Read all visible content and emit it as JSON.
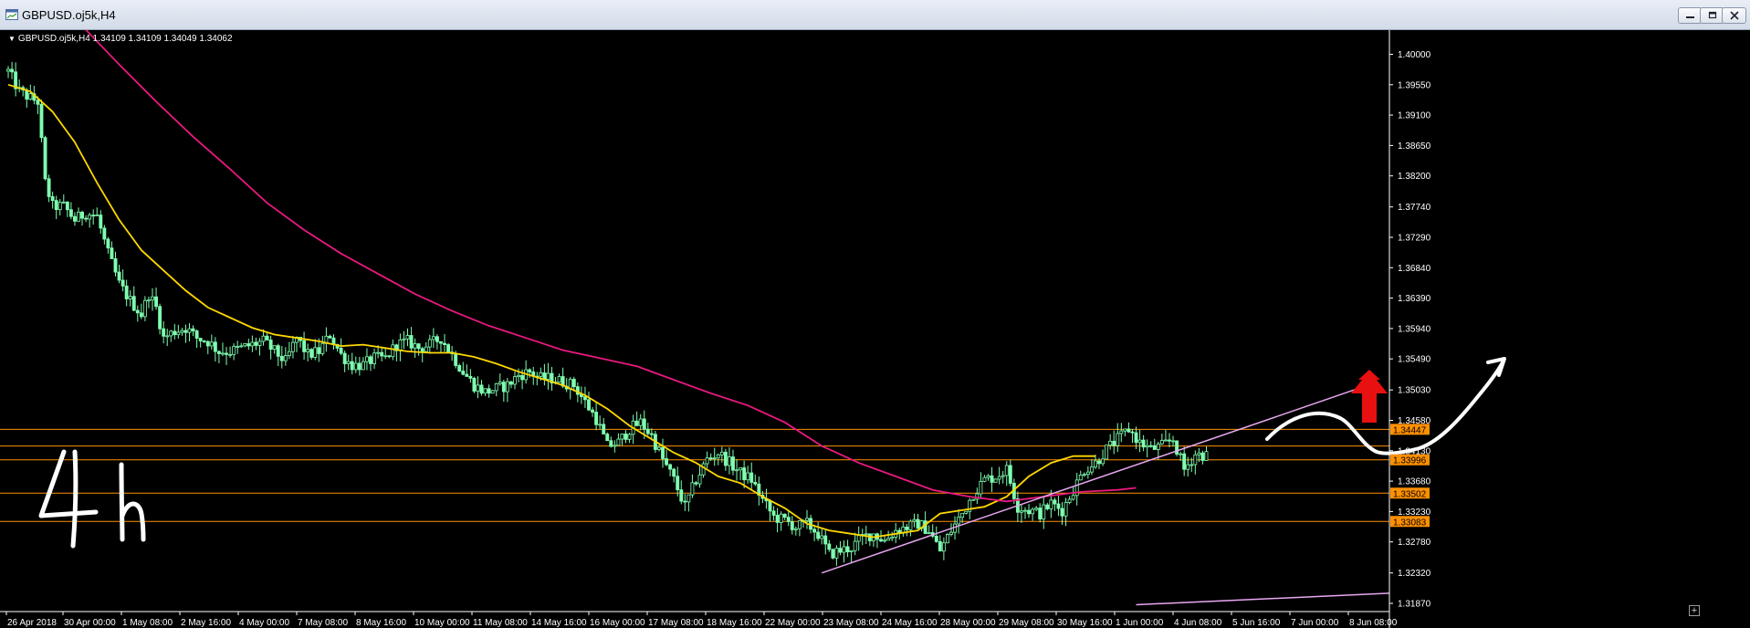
{
  "window": {
    "title": "GBPUSD.oj5k,H4",
    "icon": "chart-window-icon",
    "buttons": [
      "minimize-icon",
      "restore-icon",
      "close-icon"
    ]
  },
  "chart_header": "GBPUSD.oj5k,H4  1.34109 1.34109 1.34049 1.34062",
  "annotation_text": "4 h",
  "colors": {
    "background": "#000000",
    "bull": "#7fffb0",
    "bear": "#000000",
    "ma_fast": "#ffd700",
    "ma_slow": "#e8197f",
    "hline": "#ff9000",
    "trendline": "#e8a8f0",
    "arrow": "#e81010",
    "drawing": "#ffffff",
    "axis_text": "#ffffff"
  },
  "chart_data": {
    "type": "candlestick",
    "symbol": "GBPUSD.oj5k",
    "timeframe": "H4",
    "ohlc_last": {
      "open": 1.34109,
      "high": 1.34109,
      "low": 1.34049,
      "close": 1.34062
    },
    "y_ticks": [
      "1.40000",
      "1.39550",
      "1.39100",
      "1.38650",
      "1.38200",
      "1.37740",
      "1.37290",
      "1.36840",
      "1.36390",
      "1.35940",
      "1.35490",
      "1.35030",
      "1.34580",
      "1.34130",
      "1.33680",
      "1.33230",
      "1.32780",
      "1.32320",
      "1.31870"
    ],
    "ylim": [
      1.3187,
      1.4025
    ],
    "x_ticks": [
      "26 Apr 2018",
      "30 Apr 00:00",
      "1 May 08:00",
      "2 May 16:00",
      "4 May 00:00",
      "7 May 08:00",
      "8 May 16:00",
      "10 May 00:00",
      "11 May 08:00",
      "14 May 16:00",
      "16 May 00:00",
      "17 May 08:00",
      "18 May 16:00",
      "22 May 00:00",
      "23 May 08:00",
      "24 May 16:00",
      "28 May 00:00",
      "29 May 08:00",
      "30 May 16:00",
      "1 Jun 00:00",
      "4 Jun 08:00",
      "5 Jun 16:00",
      "7 Jun 00:00",
      "8 Jun 08:00"
    ],
    "horizontal_levels": [
      {
        "price": 1.34447,
        "label": "1.34447"
      },
      {
        "price": 1.33996,
        "label": "1.33996"
      },
      {
        "price": 1.33502,
        "label": "1.33502"
      },
      {
        "price": 1.33083,
        "label": "1.33083"
      }
    ],
    "extra_level": 1.342,
    "moving_averages": [
      {
        "role": "fast",
        "values": [
          [
            0,
            1.3955
          ],
          [
            6,
            1.3945
          ],
          [
            12,
            1.3915
          ],
          [
            18,
            1.387
          ],
          [
            24,
            1.381
          ],
          [
            30,
            1.3755
          ],
          [
            36,
            1.371
          ],
          [
            42,
            1.368
          ],
          [
            48,
            1.365
          ],
          [
            54,
            1.3625
          ],
          [
            60,
            1.361
          ],
          [
            66,
            1.3595
          ],
          [
            72,
            1.3585
          ],
          [
            78,
            1.358
          ],
          [
            84,
            1.3575
          ],
          [
            90,
            1.3568
          ],
          [
            96,
            1.357
          ],
          [
            102,
            1.3565
          ],
          [
            108,
            1.356
          ],
          [
            114,
            1.3558
          ],
          [
            120,
            1.3558
          ],
          [
            126,
            1.3552
          ],
          [
            132,
            1.3542
          ],
          [
            138,
            1.353
          ],
          [
            144,
            1.352
          ],
          [
            150,
            1.351
          ],
          [
            156,
            1.3495
          ],
          [
            162,
            1.3475
          ],
          [
            168,
            1.345
          ],
          [
            174,
            1.343
          ],
          [
            180,
            1.341
          ],
          [
            186,
            1.3395
          ],
          [
            192,
            1.3375
          ],
          [
            198,
            1.3365
          ],
          [
            204,
            1.3345
          ],
          [
            210,
            1.3328
          ],
          [
            216,
            1.3305
          ],
          [
            222,
            1.3295
          ],
          [
            228,
            1.329
          ],
          [
            234,
            1.3285
          ],
          [
            240,
            1.329
          ],
          [
            246,
            1.3295
          ],
          [
            252,
            1.332
          ],
          [
            258,
            1.3325
          ],
          [
            264,
            1.333
          ],
          [
            270,
            1.3345
          ],
          [
            276,
            1.3375
          ],
          [
            282,
            1.3395
          ],
          [
            288,
            1.3405
          ],
          [
            294,
            1.3405
          ]
        ]
      },
      {
        "role": "slow",
        "values": [
          [
            20,
            1.4042
          ],
          [
            30,
            1.3985
          ],
          [
            40,
            1.393
          ],
          [
            50,
            1.3878
          ],
          [
            60,
            1.383
          ],
          [
            70,
            1.378
          ],
          [
            80,
            1.374
          ],
          [
            90,
            1.3705
          ],
          [
            100,
            1.3675
          ],
          [
            110,
            1.3645
          ],
          [
            120,
            1.362
          ],
          [
            130,
            1.3598
          ],
          [
            140,
            1.358
          ],
          [
            150,
            1.3562
          ],
          [
            160,
            1.355
          ],
          [
            170,
            1.3538
          ],
          [
            180,
            1.3518
          ],
          [
            190,
            1.3498
          ],
          [
            200,
            1.348
          ],
          [
            210,
            1.3455
          ],
          [
            220,
            1.342
          ],
          [
            230,
            1.3395
          ],
          [
            240,
            1.3375
          ],
          [
            250,
            1.3355
          ],
          [
            260,
            1.3345
          ],
          [
            270,
            1.3338
          ],
          [
            280,
            1.3345
          ],
          [
            290,
            1.3352
          ],
          [
            300,
            1.3355
          ],
          [
            305,
            1.3358
          ]
        ]
      }
    ],
    "trendlines": [
      {
        "from": [
          220,
          1.3232
        ],
        "to": [
          365,
          1.3505
        ]
      },
      {
        "from": [
          305,
          1.3185
        ],
        "to": [
          375,
          1.3202
        ]
      }
    ],
    "bars_n": 296,
    "visible_bars": 374,
    "anchors": [
      [
        0,
        1.3975
      ],
      [
        3,
        1.3945
      ],
      [
        6,
        1.3935
      ],
      [
        8,
        1.393
      ],
      [
        10,
        1.381
      ],
      [
        12,
        1.3775
      ],
      [
        15,
        1.3775
      ],
      [
        18,
        1.3755
      ],
      [
        21,
        1.3765
      ],
      [
        24,
        1.376
      ],
      [
        27,
        1.3705
      ],
      [
        30,
        1.366
      ],
      [
        33,
        1.3635
      ],
      [
        36,
        1.3615
      ],
      [
        38,
        1.3645
      ],
      [
        40,
        1.3625
      ],
      [
        42,
        1.358
      ],
      [
        45,
        1.359
      ],
      [
        48,
        1.3595
      ],
      [
        51,
        1.358
      ],
      [
        54,
        1.3575
      ],
      [
        57,
        1.356
      ],
      [
        60,
        1.356
      ],
      [
        63,
        1.3565
      ],
      [
        66,
        1.357
      ],
      [
        69,
        1.3575
      ],
      [
        72,
        1.356
      ],
      [
        75,
        1.3545
      ],
      [
        78,
        1.358
      ],
      [
        81,
        1.3555
      ],
      [
        84,
        1.356
      ],
      [
        87,
        1.3585
      ],
      [
        90,
        1.3555
      ],
      [
        93,
        1.354
      ],
      [
        96,
        1.354
      ],
      [
        99,
        1.355
      ],
      [
        102,
        1.355
      ],
      [
        105,
        1.357
      ],
      [
        108,
        1.3575
      ],
      [
        111,
        1.3565
      ],
      [
        114,
        1.357
      ],
      [
        117,
        1.358
      ],
      [
        120,
        1.3555
      ],
      [
        123,
        1.353
      ],
      [
        126,
        1.351
      ],
      [
        129,
        1.35
      ],
      [
        132,
        1.3505
      ],
      [
        135,
        1.351
      ],
      [
        138,
        1.3525
      ],
      [
        141,
        1.353
      ],
      [
        144,
        1.352
      ],
      [
        147,
        1.352
      ],
      [
        150,
        1.3515
      ],
      [
        153,
        1.351
      ],
      [
        156,
        1.3485
      ],
      [
        159,
        1.346
      ],
      [
        162,
        1.342
      ],
      [
        165,
        1.3425
      ],
      [
        168,
        1.3445
      ],
      [
        171,
        1.3455
      ],
      [
        174,
        1.3435
      ],
      [
        177,
        1.34
      ],
      [
        180,
        1.337
      ],
      [
        183,
        1.333
      ],
      [
        186,
        1.337
      ],
      [
        189,
        1.34
      ],
      [
        192,
        1.341
      ],
      [
        195,
        1.3395
      ],
      [
        198,
        1.338
      ],
      [
        201,
        1.337
      ],
      [
        204,
        1.334
      ],
      [
        207,
        1.3315
      ],
      [
        210,
        1.331
      ],
      [
        213,
        1.33
      ],
      [
        216,
        1.3305
      ],
      [
        219,
        1.329
      ],
      [
        222,
        1.326
      ],
      [
        225,
        1.3265
      ],
      [
        228,
        1.327
      ],
      [
        231,
        1.3285
      ],
      [
        234,
        1.329
      ],
      [
        237,
        1.328
      ],
      [
        240,
        1.3295
      ],
      [
        243,
        1.33
      ],
      [
        246,
        1.3305
      ],
      [
        249,
        1.3295
      ],
      [
        252,
        1.3265
      ],
      [
        255,
        1.3295
      ],
      [
        258,
        1.332
      ],
      [
        261,
        1.335
      ],
      [
        264,
        1.337
      ],
      [
        267,
        1.3375
      ],
      [
        270,
        1.3385
      ],
      [
        273,
        1.333
      ],
      [
        276,
        1.3325
      ],
      [
        279,
        1.332
      ],
      [
        282,
        1.3335
      ],
      [
        285,
        1.3325
      ],
      [
        288,
        1.3355
      ],
      [
        291,
        1.3385
      ],
      [
        294,
        1.3395
      ],
      [
        297,
        1.3415
      ],
      [
        300,
        1.343
      ],
      [
        303,
        1.3445
      ],
      [
        306,
        1.3425
      ],
      [
        309,
        1.3415
      ],
      [
        312,
        1.342
      ],
      [
        315,
        1.343
      ],
      [
        318,
        1.3385
      ],
      [
        321,
        1.3408
      ],
      [
        324,
        1.3406
      ]
    ]
  }
}
